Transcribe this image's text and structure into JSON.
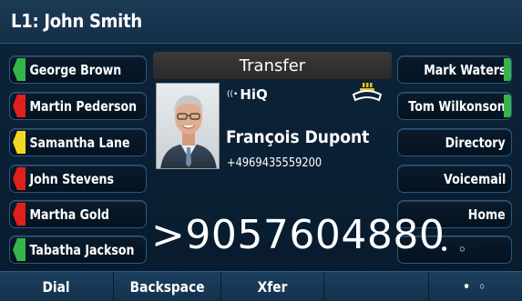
{
  "title": "L1: John Smith",
  "left_keys": [
    {
      "label": "George Brown",
      "led_color": "#36b44a"
    },
    {
      "label": "Martin Pederson",
      "led_color": "#e0201d"
    },
    {
      "label": "Samantha Lane",
      "led_color": "#f2d820"
    },
    {
      "label": "John Stevens",
      "led_color": "#e0201d"
    },
    {
      "label": "Martha Gold",
      "led_color": "#e0201d"
    },
    {
      "label": "Tabatha Jackson",
      "led_color": "#36b44a"
    }
  ],
  "right_keys": [
    {
      "label": "Mark Waters",
      "led_color": "#36b44a"
    },
    {
      "label": "Tom Wilkonson",
      "led_color": "#36b44a"
    },
    {
      "label": "Directory"
    },
    {
      "label": "Voicemail"
    },
    {
      "label": "Home"
    },
    {
      "label": "• ◦"
    }
  ],
  "call": {
    "status": "Transfer",
    "network_label": "HiQ",
    "contact_name": "François Dupont",
    "contact_number": "+4969435559200",
    "dialed_number": ">9057604880"
  },
  "softkeys": [
    "Dial",
    "Backspace",
    "Xfer",
    "",
    "• ◦"
  ],
  "icons": {
    "network": "hiq-wireless-icon",
    "call_state": "handset-on-hook-icon",
    "contact": "contact-photo-avatar"
  }
}
